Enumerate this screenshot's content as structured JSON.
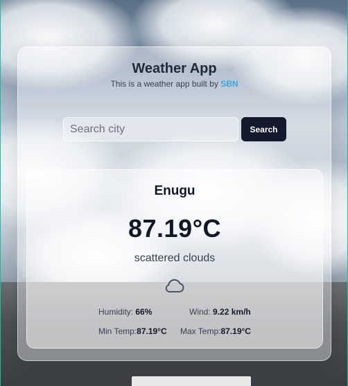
{
  "header": {
    "title": "Weather App",
    "subtitle": "This is a weather app built by",
    "brand": "SBN"
  },
  "search": {
    "placeholder": "Search city",
    "value": "",
    "button_label": "Search"
  },
  "weather": {
    "city": "Enugu",
    "temperature": "87.19°C",
    "description": "scattered clouds",
    "icon": "cloud-icon",
    "humidity_label": "Humidity:",
    "humidity_value": "66%",
    "wind_label": "Wind:",
    "wind_value": "9.22 km/h",
    "min_temp_label": "Min Temp:",
    "min_temp_value": "87.19°C",
    "max_temp_label": "Max Temp:",
    "max_temp_value": "87.19°C"
  },
  "colors": {
    "brand": "#38a9e8",
    "button_bg": "#121a2b"
  }
}
